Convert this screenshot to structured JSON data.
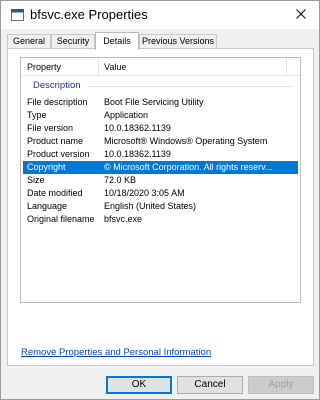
{
  "window": {
    "title": "bfsvc.exe Properties",
    "icons": {
      "app": "window-file-icon",
      "close": "close-icon"
    }
  },
  "tabs": [
    {
      "label": "General",
      "active": false
    },
    {
      "label": "Security",
      "active": false
    },
    {
      "label": "Details",
      "active": true
    },
    {
      "label": "Previous Versions",
      "active": false
    }
  ],
  "details": {
    "columns": {
      "property": "Property",
      "value": "Value"
    },
    "group": "Description",
    "rows": [
      {
        "property": "File description",
        "value": "Boot File Servicing Utility",
        "selected": false
      },
      {
        "property": "Type",
        "value": "Application",
        "selected": false
      },
      {
        "property": "File version",
        "value": "10.0.18362.1139",
        "selected": false
      },
      {
        "property": "Product name",
        "value": "Microsoft® Windows® Operating System",
        "selected": false
      },
      {
        "property": "Product version",
        "value": "10.0.18362.1139",
        "selected": false
      },
      {
        "property": "Copyright",
        "value": "© Microsoft Corporation. All rights reserv...",
        "selected": true
      },
      {
        "property": "Size",
        "value": "72.0 KB",
        "selected": false
      },
      {
        "property": "Date modified",
        "value": "10/18/2020 3:05 AM",
        "selected": false
      },
      {
        "property": "Language",
        "value": "English (United States)",
        "selected": false
      },
      {
        "property": "Original filename",
        "value": "bfsvc.exe",
        "selected": false
      }
    ]
  },
  "remove_link": "Remove Properties and Personal Information",
  "buttons": {
    "ok": "OK",
    "cancel": "Cancel",
    "apply": "Apply"
  },
  "colors": {
    "selection": "#0078d7",
    "group_text": "#1e3287",
    "link": "#0645ad"
  }
}
